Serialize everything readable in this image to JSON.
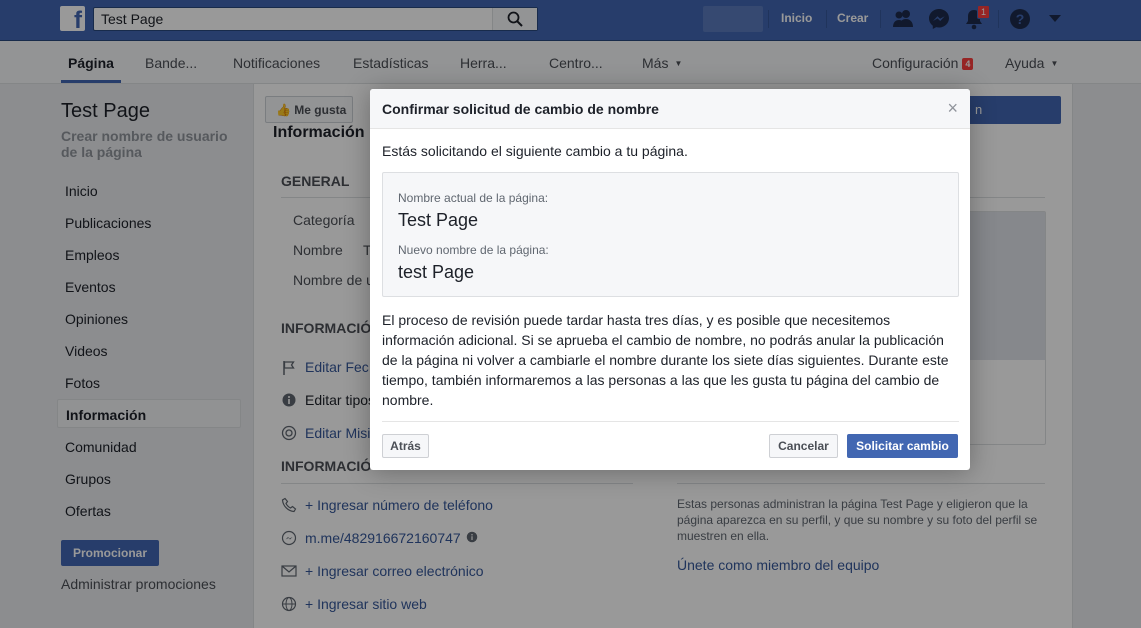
{
  "topbar": {
    "logo": "f",
    "search_value": "Test Page",
    "links": [
      "Inicio",
      "Crear"
    ],
    "notification_count": "1",
    "icons": [
      "friend-requests-icon",
      "messenger-icon",
      "notifications-bell-icon",
      "help-icon",
      "account-menu-caret-icon"
    ],
    "brand_color": "#4267b2"
  },
  "page_tabs": {
    "items": [
      "Página",
      "Bande...",
      "Notificaciones",
      "Estadísticas",
      "Herra...",
      "Centro...",
      "Más"
    ],
    "settings_label": "Configuración",
    "settings_badge": "4",
    "help_label": "Ayuda"
  },
  "sidebar": {
    "page_title": "Test Page",
    "username_prompt": "Crear nombre de usuario de la página",
    "items": [
      "Inicio",
      "Publicaciones",
      "Empleos",
      "Eventos",
      "Opiniones",
      "Videos",
      "Fotos",
      "Información",
      "Comunidad",
      "Grupos",
      "Ofertas"
    ],
    "active_item": "Información",
    "promote_button": "Promocionar",
    "manage_promotions": "Administrar promociones"
  },
  "background": {
    "like_button": "Me gusta",
    "blue_button_tail": "n",
    "section_partial": "Información",
    "general_header": "GENERAL",
    "general_rows": [
      "Categoría",
      "Nombre",
      "Nombre de u"
    ],
    "name_value_partial": "T",
    "info_header_partial": "INFORMACIÓ",
    "edit_links": [
      "Editar Fec",
      "Editar tipos",
      "Editar Misi"
    ],
    "contact_header_partial": "INFORMACIÓ",
    "contact_links": [
      "+ Ingresar número de teléfono",
      "m.me/482916672160747",
      "+ Ingresar correo electrónico",
      "+ Ingresar sitio web"
    ],
    "members_text": "Estas personas administran la página Test Page y eligieron que la página aparezca en su perfil, y que su nombre y su foto del perfil se muestren en ella.",
    "join_link": "Únete como miembro del equipo"
  },
  "dialog": {
    "title": "Confirmar solicitud de cambio de nombre",
    "close": "×",
    "intro": "Estás solicitando el siguiente cambio a tu página.",
    "current_label": "Nombre actual de la página:",
    "current_value": "Test Page",
    "new_label": "Nuevo nombre de la página:",
    "new_value": "test Page",
    "body": "El proceso de revisión puede tardar hasta tres días, y es posible que necesitemos información adicional. Si se aprueba el cambio de nombre, no podrás anular la publicación de la página ni volver a cambiarle el nombre durante los siete días siguientes. Durante este tiempo, también informaremos a las personas a las que les gusta tu página del cambio de nombre.",
    "back_button": "Atrás",
    "cancel_button": "Cancelar",
    "submit_button": "Solicitar cambio"
  }
}
